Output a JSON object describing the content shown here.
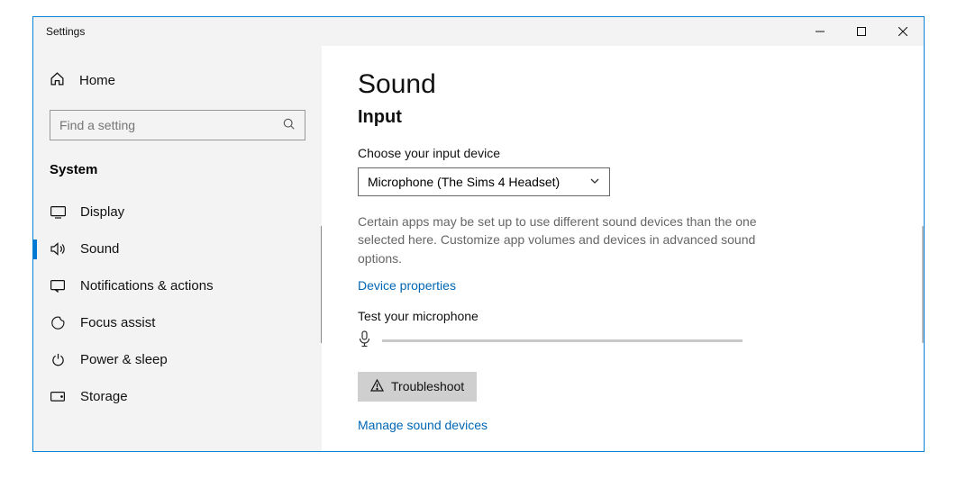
{
  "window": {
    "title": "Settings"
  },
  "sidebar": {
    "home": "Home",
    "search_placeholder": "Find a setting",
    "category": "System",
    "items": [
      {
        "label": "Display"
      },
      {
        "label": "Sound"
      },
      {
        "label": "Notifications & actions"
      },
      {
        "label": "Focus assist"
      },
      {
        "label": "Power & sleep"
      },
      {
        "label": "Storage"
      }
    ]
  },
  "content": {
    "page_title": "Sound",
    "section": "Input",
    "choose_label": "Choose your input device",
    "device_selected": "Microphone (The Sims 4 Headset)",
    "description": "Certain apps may be set up to use different sound devices than the one selected here. Customize app volumes and devices in advanced sound options.",
    "device_properties": "Device properties",
    "test_label": "Test your microphone",
    "troubleshoot": "Troubleshoot",
    "manage": "Manage sound devices"
  }
}
